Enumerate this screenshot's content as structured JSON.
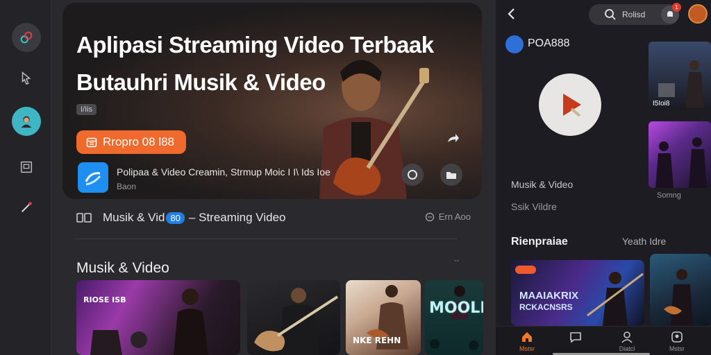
{
  "hero": {
    "title_line1": "Aplipasi Streaming Video Terbaak",
    "title_line2": "Butauhri Musik & Video",
    "tag": "I/Iis",
    "cta_label": "Rropro 08 l88",
    "app_name": "Polipaa & Video Creamin, Strmup Moic I I\\ Ids Ioe",
    "app_sub": "Baon"
  },
  "info_row": {
    "prefix": "Musik & Vid",
    "badge": "80",
    "suffix": "– Streaming Video",
    "right": "Ern Aoo"
  },
  "section": {
    "title": "Musik & Video",
    "more": "--"
  },
  "thumbnails": [
    {
      "label": "RIOSE ISB"
    },
    {
      "label": ""
    },
    {
      "label": "NKE REHN"
    },
    {
      "label": "MOOLDI"
    }
  ],
  "panel": {
    "search_text": "Rolisd",
    "notif_count": "1",
    "channel_name": "POA888",
    "card1_caption": "I5Ioi8",
    "card2_caption": "Somng",
    "text1": "Musik & Video",
    "text2": "Ssik Vildre",
    "section_left": "Rienpraiae",
    "section_right": "Yeath Idre",
    "feature_badge": "",
    "feature_title_1": "MAAIAKRIX",
    "feature_title_2": "RCKACNSRS"
  },
  "bottom_nav": [
    {
      "label": "Mstsr",
      "icon": "home-icon",
      "active": true
    },
    {
      "label": "",
      "icon": "chat-icon",
      "active": false
    },
    {
      "label": "Diatcl",
      "icon": "user-icon",
      "active": false
    },
    {
      "label": "Mstsr",
      "icon": "profile-icon",
      "active": false
    }
  ],
  "colors": {
    "accent_orange": "#ef6a2c",
    "accent_blue": "#1f7fe6",
    "background": "#202024"
  }
}
